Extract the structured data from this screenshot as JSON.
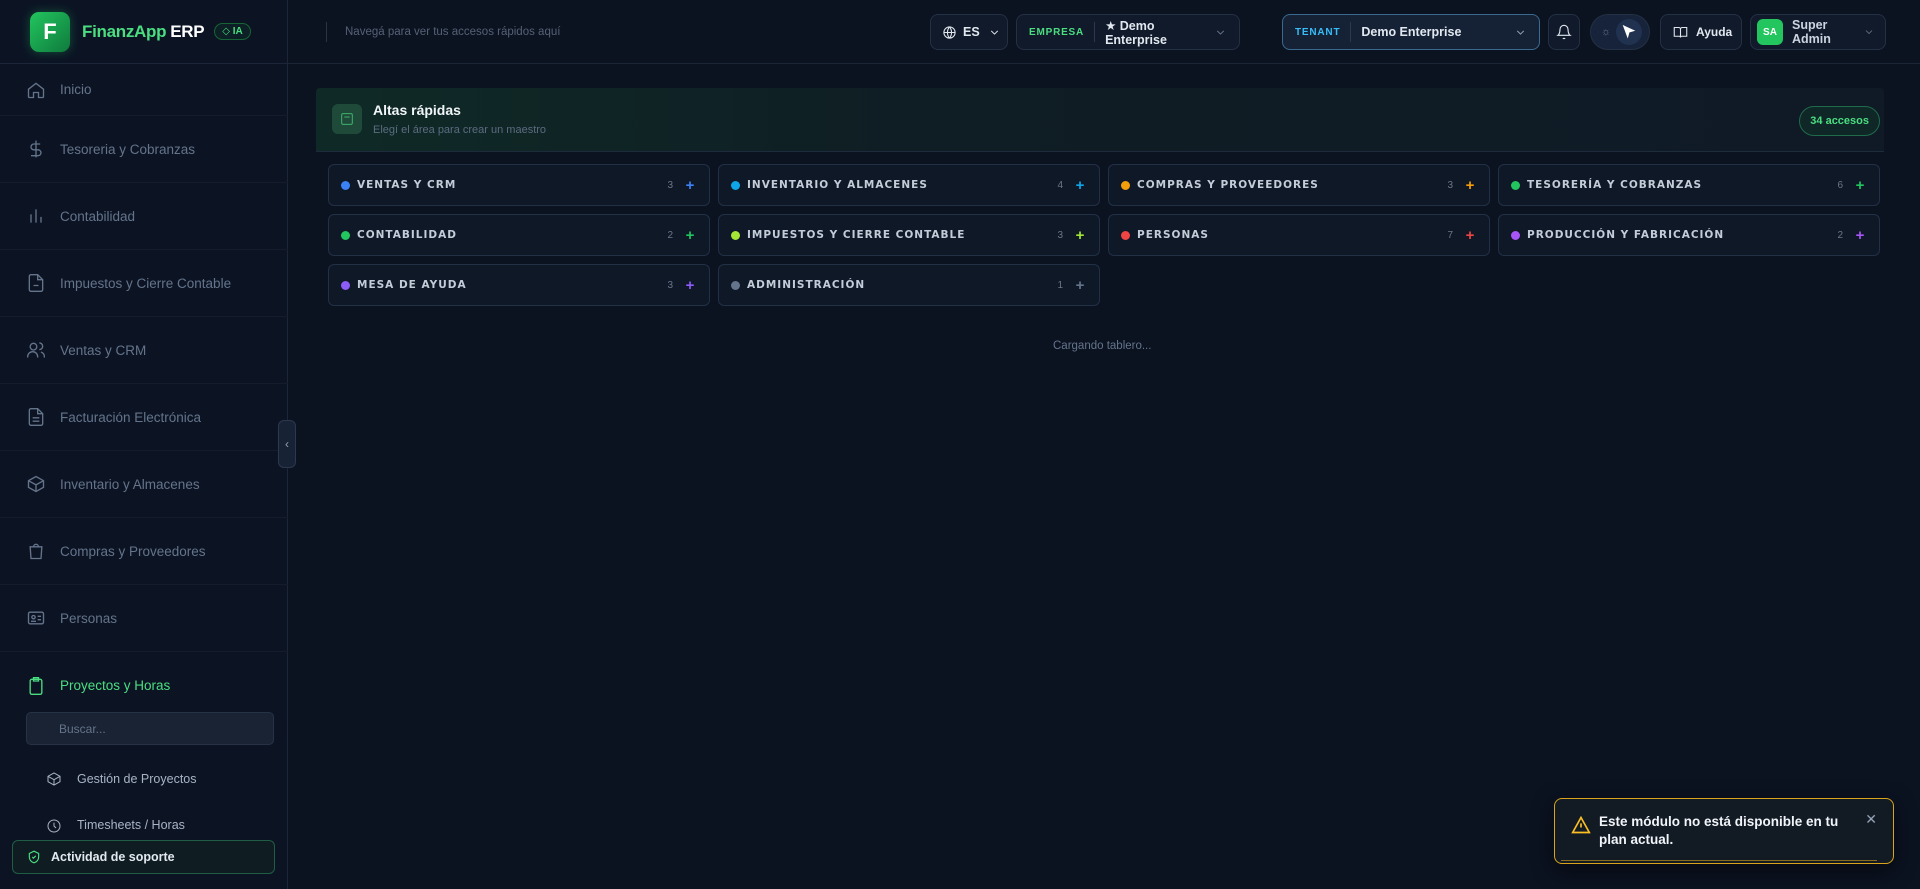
{
  "brand": {
    "name": "FinanzApp",
    "suffix": "ERP",
    "badge": "IA",
    "logo_letter": "F"
  },
  "sidebar": {
    "items": [
      {
        "label": "Inicio",
        "icon": "home-icon"
      },
      {
        "label": "Tesoreria y Cobranzas",
        "icon": "dollar-icon"
      },
      {
        "label": "Contabilidad",
        "icon": "bar-chart-icon"
      },
      {
        "label": "Impuestos y Cierre Contable",
        "icon": "document-icon"
      },
      {
        "label": "Ventas y CRM",
        "icon": "users-icon"
      },
      {
        "label": "Facturación Electrónica",
        "icon": "file-text-icon"
      },
      {
        "label": "Inventario y Almacenes",
        "icon": "box-icon"
      },
      {
        "label": "Compras y Proveedores",
        "icon": "shopping-bag-icon"
      },
      {
        "label": "Personas",
        "icon": "id-card-icon"
      },
      {
        "label": "Proyectos y Horas",
        "icon": "clipboard-icon"
      }
    ],
    "search_placeholder": "Buscar...",
    "sub_items": [
      {
        "label": "Gestión de Proyectos",
        "icon": "cube-icon"
      },
      {
        "label": "Timesheets / Horas",
        "icon": "clock-icon"
      }
    ],
    "support_label": "Actividad de soporte"
  },
  "topbar": {
    "hint": "Navegá para ver tus accesos rápidos aquí",
    "language": "ES",
    "empresa_label": "EMPRESA",
    "empresa_value": "★ Demo Enterprise",
    "tenant_label": "TENANT",
    "tenant_value": "Demo Enterprise",
    "help_label": "Ayuda",
    "user_initials": "SA",
    "user_name": "Super Admin"
  },
  "altas": {
    "title": "Altas rápidas",
    "subtitle": "Elegí el área para crear un maestro",
    "badge": "34 accesos"
  },
  "areas": [
    {
      "label": "VENTAS Y CRM",
      "count": "3",
      "color": "#3b82f6"
    },
    {
      "label": "INVENTARIO Y ALMACENES",
      "count": "4",
      "color": "#0ea5e9"
    },
    {
      "label": "COMPRAS Y PROVEEDORES",
      "count": "3",
      "color": "#f59e0b"
    },
    {
      "label": "TESORERÍA Y COBRANZAS",
      "count": "6",
      "color": "#22c55e"
    },
    {
      "label": "CONTABILIDAD",
      "count": "2",
      "color": "#22c55e"
    },
    {
      "label": "IMPUESTOS Y CIERRE CONTABLE",
      "count": "3",
      "color": "#a3e635"
    },
    {
      "label": "PERSONAS",
      "count": "7",
      "color": "#ef4444"
    },
    {
      "label": "PRODUCCIÓN Y FABRICACIÓN",
      "count": "2",
      "color": "#a855f7"
    },
    {
      "label": "MESA DE AYUDA",
      "count": "3",
      "color": "#8b5cf6"
    },
    {
      "label": "ADMINISTRACIÓN",
      "count": "1",
      "color": "#64748b"
    }
  ],
  "loading_text": "Cargando tablero...",
  "toast": {
    "message": "Este módulo no está disponible en tu plan actual."
  }
}
